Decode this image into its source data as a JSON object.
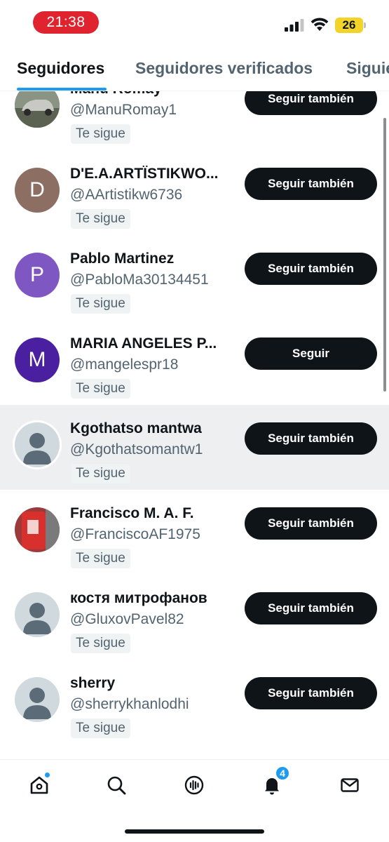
{
  "status_bar": {
    "time": "21:38",
    "battery": "26",
    "colors": {
      "time_pill": "#e0242f",
      "battery": "#f2d329"
    }
  },
  "tabs": [
    {
      "label": "Seguidores",
      "active": true
    },
    {
      "label": "Seguidores verificados",
      "active": false
    },
    {
      "label": "Siguie",
      "active": false
    }
  ],
  "followers": [
    {
      "name": "Manu Romay",
      "handle": "@ManuRomay1",
      "badge": "Te sigue",
      "button": "Seguir también",
      "avatar": "photo-car-icon"
    },
    {
      "name": "D'E.A.ARTÏSTIKWO...",
      "handle": "@AArtistikw6736",
      "badge": "Te sigue",
      "button": "Seguir también",
      "avatar_letter": "D",
      "avatar_color": "#8d6e63"
    },
    {
      "name": "Pablo Martinez",
      "handle": "@PabloMa30134451",
      "badge": "Te sigue",
      "button": "Seguir también",
      "avatar_letter": "P",
      "avatar_color": "#7e57c2"
    },
    {
      "name": "MARIA ANGELES P...",
      "handle": "@mangelespr18",
      "badge": "Te sigue",
      "button": "Seguir",
      "avatar_letter": "M",
      "avatar_color": "#4a20a0"
    },
    {
      "name": "Kgothatso mantwa",
      "handle": "@Kgothatsomantw1",
      "badge": "Te sigue",
      "button": "Seguir también",
      "avatar": "default-avatar-icon",
      "highlighted": true
    },
    {
      "name": "Francisco M. A. F.",
      "handle": "@FranciscoAF1975",
      "badge": "Te sigue",
      "button": "Seguir también",
      "avatar": "photo-red-icon"
    },
    {
      "name": "костя митрофанов",
      "handle": "@GluxovPavel82",
      "badge": "Te sigue",
      "button": "Seguir también",
      "avatar": "default-avatar-icon"
    },
    {
      "name": "sherry",
      "handle": "@sherrykhanlodhi",
      "badge": "Te sigue",
      "button": "Seguir también",
      "avatar": "default-avatar-icon"
    }
  ],
  "bottom_nav": {
    "items": [
      "home-icon",
      "search-icon",
      "spaces-icon",
      "notifications-icon",
      "messages-icon"
    ],
    "notifications_count": "4"
  },
  "accent_color": "#1d9bf0"
}
